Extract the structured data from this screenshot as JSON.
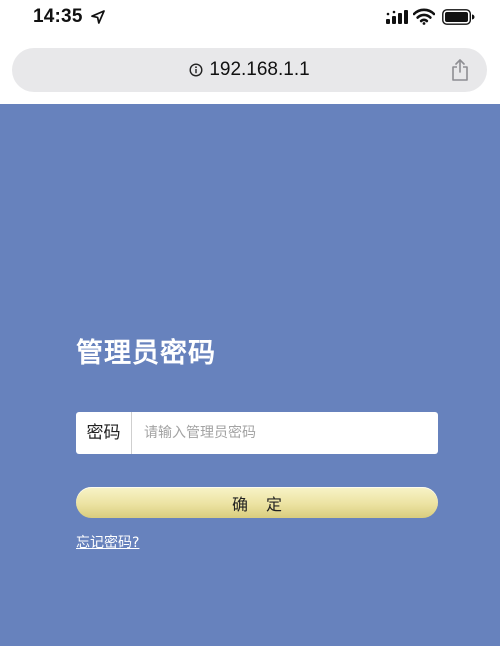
{
  "status_bar": {
    "time": "14:35",
    "icons": [
      "location-arrow-icon",
      "signal-icon",
      "wifi-icon",
      "battery-icon"
    ]
  },
  "address_bar": {
    "url": "192.168.1.1",
    "icons": [
      "info-icon",
      "share-icon"
    ]
  },
  "login": {
    "title": "管理员密码",
    "field_label": "密码",
    "password_placeholder": "请输入管理员密码",
    "password_value": "",
    "confirm_label": "确定",
    "forgot_link": "忘记密码?"
  },
  "colors": {
    "page_background": "#6782bd",
    "button_gradient_top": "#f8f3c8",
    "button_gradient_bottom": "#d9cc7e",
    "address_bar_background": "#e8e8ea"
  }
}
